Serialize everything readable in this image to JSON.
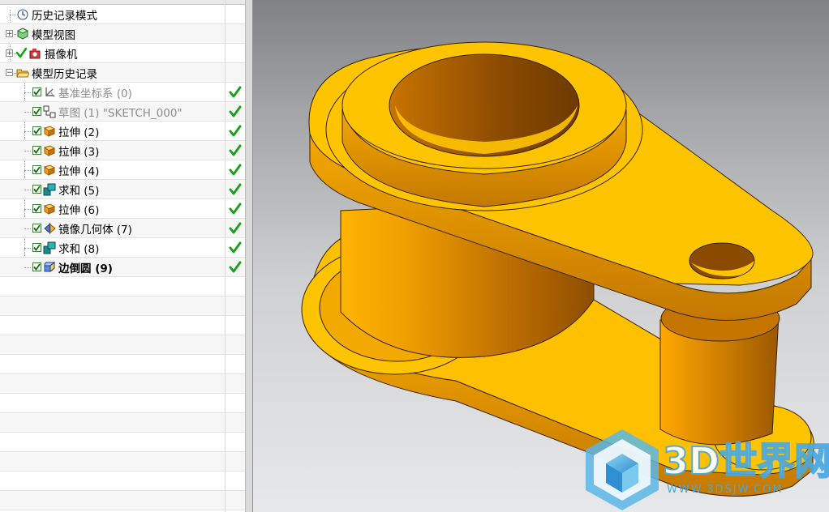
{
  "navigator": {
    "items": [
      {
        "label": "历史记录模式",
        "icon": "clock-icon",
        "level": 0
      },
      {
        "label": "模型视图",
        "icon": "model-view-icon",
        "level": 0,
        "expander": "+"
      },
      {
        "label": "摄像机",
        "icon": "camera-icon",
        "level": 0,
        "expander": "+",
        "checked": true
      },
      {
        "label": "模型历史记录",
        "icon": "folder-open-icon",
        "level": 0,
        "expander": "-"
      },
      {
        "label": "基准坐标系 (0)",
        "icon": "datum-csys-icon",
        "level": 1,
        "dim": true,
        "status": "ok"
      },
      {
        "label": "草图 (1) \"SKETCH_000\"",
        "icon": "sketch-icon",
        "level": 1,
        "dim": true,
        "status": "ok"
      },
      {
        "label": "拉伸 (2)",
        "icon": "extrude-icon",
        "level": 1,
        "status": "ok"
      },
      {
        "label": "拉伸 (3)",
        "icon": "extrude-icon",
        "level": 1,
        "status": "ok"
      },
      {
        "label": "拉伸 (4)",
        "icon": "extrude-icon",
        "level": 1,
        "status": "ok"
      },
      {
        "label": "求和 (5)",
        "icon": "unite-icon",
        "level": 1,
        "status": "ok"
      },
      {
        "label": "拉伸 (6)",
        "icon": "extrude-icon",
        "level": 1,
        "status": "ok"
      },
      {
        "label": "镜像几何体 (7)",
        "icon": "mirror-geometry-icon",
        "level": 1,
        "status": "ok"
      },
      {
        "label": "求和 (8)",
        "icon": "unite-icon",
        "level": 1,
        "status": "ok"
      },
      {
        "label": "边倒圆 (9)",
        "icon": "edge-blend-icon",
        "level": 1,
        "bold": true,
        "status": "ok"
      }
    ]
  },
  "watermark": {
    "text": "3D世界网",
    "url": "WWW.3DSJW.COM"
  },
  "colors": {
    "part": "#ffc000",
    "part_dark": "#d88400",
    "status_ok": "#1aa31a",
    "check": "#2e8b2e"
  }
}
